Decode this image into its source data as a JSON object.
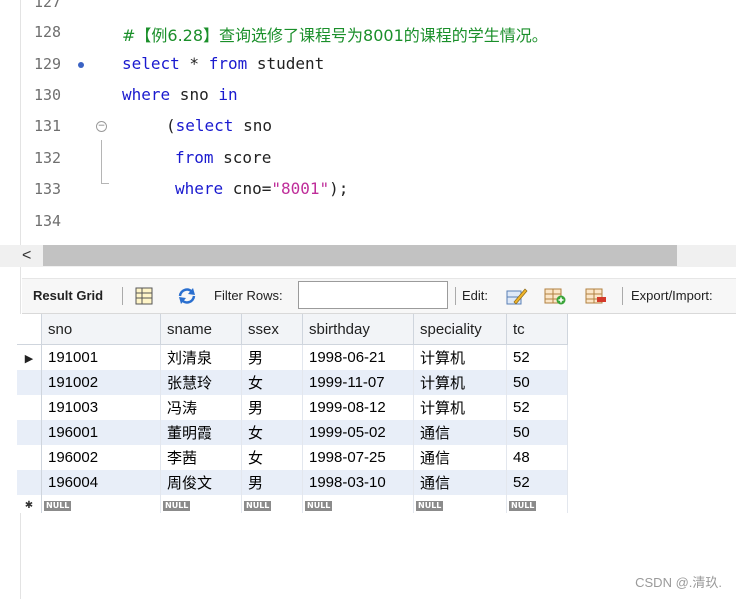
{
  "editor": {
    "lines": [
      {
        "num": "127",
        "parts": []
      },
      {
        "num": "128",
        "parts": [
          {
            "t": "#【例6.28】查询选修了课程号为8001的课程的学生情况。",
            "c": "cm"
          }
        ]
      },
      {
        "num": "129",
        "parts": [
          {
            "t": "select",
            "c": "kw"
          },
          {
            "t": " * ",
            "c": ""
          },
          {
            "t": "from",
            "c": "kw"
          },
          {
            "t": " student",
            "c": ""
          }
        ]
      },
      {
        "num": "130",
        "parts": [
          {
            "t": "where",
            "c": "kw"
          },
          {
            "t": " sno ",
            "c": ""
          },
          {
            "t": "in",
            "c": "kw"
          }
        ]
      },
      {
        "num": "131",
        "parts": [
          {
            "t": "(",
            "c": ""
          },
          {
            "t": "select",
            "c": "kw"
          },
          {
            "t": " sno",
            "c": ""
          }
        ]
      },
      {
        "num": "132",
        "parts": [
          {
            "t": "from",
            "c": "kw"
          },
          {
            "t": " score",
            "c": ""
          }
        ]
      },
      {
        "num": "133",
        "parts": [
          {
            "t": "where",
            "c": "kw"
          },
          {
            "t": " cno=",
            "c": ""
          },
          {
            "t": "\"8001\"",
            "c": "str"
          },
          {
            "t": ");",
            "c": ""
          }
        ]
      },
      {
        "num": "134",
        "parts": []
      }
    ]
  },
  "toolbar": {
    "result_grid": "Result Grid",
    "filter_rows": "Filter Rows:",
    "filter_value": "",
    "edit": "Edit:",
    "export_import": "Export/Import:"
  },
  "grid": {
    "columns": [
      "sno",
      "sname",
      "ssex",
      "sbirthday",
      "speciality",
      "tc"
    ],
    "rows": [
      [
        "191001",
        "刘清泉",
        "男",
        "1998-06-21",
        "计算机",
        "52"
      ],
      [
        "191002",
        "张慧玲",
        "女",
        "1999-11-07",
        "计算机",
        "50"
      ],
      [
        "191003",
        "冯涛",
        "男",
        "1999-08-12",
        "计算机",
        "52"
      ],
      [
        "196001",
        "董明霞",
        "女",
        "1999-05-02",
        "通信",
        "50"
      ],
      [
        "196002",
        "李茜",
        "女",
        "1998-07-25",
        "通信",
        "48"
      ],
      [
        "196004",
        "周俊文",
        "男",
        "1998-03-10",
        "通信",
        "52"
      ]
    ],
    "null_label": "NULL"
  },
  "watermark": "CSDN @.清玖."
}
